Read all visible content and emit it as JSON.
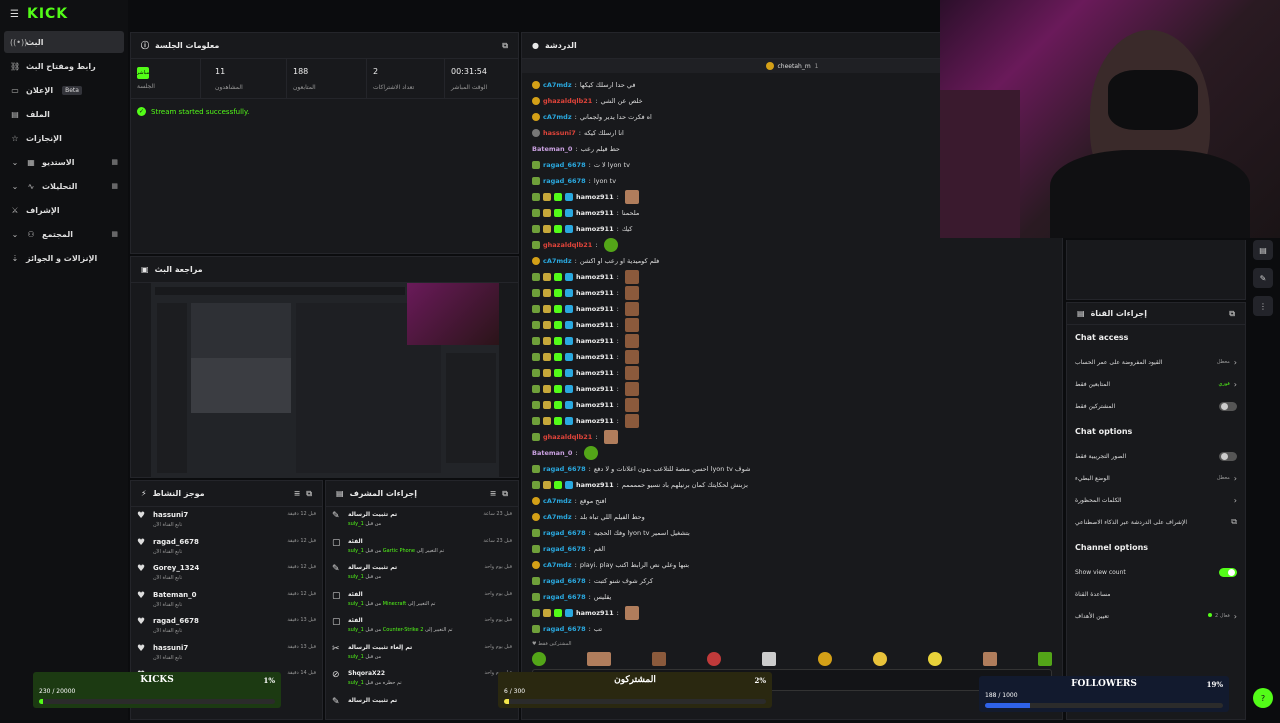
{
  "brand": "KICK",
  "nav": [
    {
      "label": "البث",
      "icon": "stream-icon",
      "active": true
    },
    {
      "label": "رابط ومفتاح البث",
      "icon": "link-icon"
    },
    {
      "label": "الإعلان",
      "icon": "ad-icon",
      "beta": "Beta"
    },
    {
      "label": "الملف",
      "icon": "file-icon"
    },
    {
      "label": "الإنجازات",
      "icon": "achievement-icon"
    },
    {
      "label": "الاستديو",
      "icon": "studio-icon",
      "chev": true
    },
    {
      "label": "التحليلات",
      "icon": "analytics-icon",
      "chev": true
    },
    {
      "label": "الإشراف",
      "icon": "moderation-icon"
    },
    {
      "label": "المجتمع",
      "icon": "community-icon",
      "chev": true
    },
    {
      "label": "الإنزالات و الجوائز",
      "icon": "drops-icon"
    }
  ],
  "session": {
    "title": "معلومات الجلسة",
    "live_badge": "مباشر",
    "live_label": "الجلسة",
    "stats": [
      {
        "value": "11",
        "label": "المشاهدون"
      },
      {
        "value": "188",
        "label": "المتابعون"
      },
      {
        "value": "2",
        "label": "تعداد الاشتراكات"
      },
      {
        "value": "00:31:54",
        "label": "الوقت المباشر"
      }
    ],
    "status": "Stream started successfully."
  },
  "preview_title": "مراجعة البث",
  "activity": {
    "title": "موجز النشاط",
    "items": [
      {
        "name": "hassuni7",
        "sub": "تابع القناة الآن",
        "time": "قبل 12 دقيقة"
      },
      {
        "name": "ragad_6678",
        "sub": "تابع القناة الآن",
        "time": "قبل 12 دقيقة"
      },
      {
        "name": "Gorey_1324",
        "sub": "تابع القناة الآن",
        "time": "قبل 12 دقيقة"
      },
      {
        "name": "Bateman_0",
        "sub": "تابع القناة الآن",
        "time": "قبل 12 دقيقة"
      },
      {
        "name": "ragad_6678",
        "sub": "تابع القناة الآن",
        "time": "قبل 13 دقيقة"
      },
      {
        "name": "hassuni7",
        "sub": "تابع القناة الآن",
        "time": "قبل 13 دقيقة"
      },
      {
        "name": "",
        "sub": "",
        "time": "قبل 14 دقيقة"
      }
    ]
  },
  "mod": {
    "title": "إجراءات المشرف",
    "items": [
      {
        "title": "تم تثبيت الرسالة",
        "sub": "من قبل",
        "user": "suly_1",
        "time": "قبل 23 ساعة"
      },
      {
        "title": "الفئة",
        "sub": "تم التغيير إلى",
        "user": "Gartic Phone",
        "by": "من قبل",
        "by_user": "suly_1",
        "time": "قبل 23 ساعة"
      },
      {
        "title": "تم تثبيت الرسالة",
        "sub": "من قبل",
        "user": "suly_1",
        "time": "قبل يوم واحد"
      },
      {
        "title": "الفئة",
        "sub": "تم التغيير إلى",
        "user": "Minecraft",
        "by": "من قبل",
        "by_user": "suly_1",
        "time": "قبل يوم واحد"
      },
      {
        "title": "الفئة",
        "sub": "تم التغيير إلى",
        "user": "Counter-Strike 2",
        "by": "من قبل",
        "by_user": "suly_1",
        "time": "قبل يوم واحد"
      },
      {
        "title": "تم إلغاء تثبيت الرسالة",
        "sub": "من قبل",
        "user": "suly_1",
        "time": "قبل يوم واحد"
      },
      {
        "title": "ShqoraX22",
        "sub": "تم حظره من قبل",
        "user": "suly_1",
        "time": "قبل يوم واحد"
      },
      {
        "title": "تم تثبيت الرسالة",
        "sub": "",
        "user": "",
        "time": "واحد"
      }
    ]
  },
  "chat": {
    "title": "الدردشة",
    "pinned_user": "cheetah_m",
    "pinned_count": "1",
    "lines": [
      {
        "user": "cA7mdz",
        "color": "#2aa9e0",
        "badges": [
          "b-gold"
        ],
        "msg": "في حدا ارسلك كيكها"
      },
      {
        "user": "ghazaldqlb21",
        "color": "#e0443a",
        "badges": [
          "b-gold"
        ],
        "msg": "خلص عن الشي"
      },
      {
        "user": "cA7mdz",
        "color": "#2aa9e0",
        "badges": [
          "b-gold"
        ],
        "msg": "اه فكرت حدا يدير ولجماني"
      },
      {
        "user": "hassuni7",
        "color": "#e0443a",
        "badges": [
          "b-grey"
        ],
        "msg": "انا ارسلك كيكه"
      },
      {
        "user": "Bateman_0",
        "color": "#c9a0e0",
        "badges": [],
        "msg": "حط فيلم رعب"
      },
      {
        "user": "ragad_6678",
        "color": "#2aa9e0",
        "badges": [
          "b-og"
        ],
        "msg": "لا ت lyon tv"
      },
      {
        "user": "ragad_6678",
        "color": "#2aa9e0",
        "badges": [
          "b-og"
        ],
        "msg": "lyon tv"
      },
      {
        "user": "hamoz911",
        "color": "#eee",
        "badges": [
          "b-og",
          "b-sub",
          "b-vip",
          "b-mod"
        ],
        "msg": "",
        "emote": "c"
      },
      {
        "user": "hamoz911",
        "color": "#eee",
        "badges": [
          "b-og",
          "b-sub",
          "b-vip",
          "b-mod"
        ],
        "msg": "ملحمنا"
      },
      {
        "user": "hamoz911",
        "color": "#eee",
        "badges": [
          "b-og",
          "b-sub",
          "b-vip",
          "b-mod"
        ],
        "msg": "كيك"
      },
      {
        "user": "ghazaldqlb21",
        "color": "#e0443a",
        "badges": [
          "b-og"
        ],
        "msg": "",
        "emote": "g"
      },
      {
        "user": "cA7mdz",
        "color": "#2aa9e0",
        "badges": [
          "b-gold"
        ],
        "msg": "فلم كوميدية او رعب او اكشن"
      },
      {
        "user": "hamoz911",
        "color": "#eee",
        "badges": [
          "b-og",
          "b-sub",
          "b-vip",
          "b-mod"
        ],
        "msg": "",
        "emote": "e"
      },
      {
        "user": "hamoz911",
        "color": "#eee",
        "badges": [
          "b-og",
          "b-sub",
          "b-vip",
          "b-mod"
        ],
        "msg": "",
        "emote": "e"
      },
      {
        "user": "hamoz911",
        "color": "#eee",
        "badges": [
          "b-og",
          "b-sub",
          "b-vip",
          "b-mod"
        ],
        "msg": "",
        "emote": "e"
      },
      {
        "user": "hamoz911",
        "color": "#eee",
        "badges": [
          "b-og",
          "b-sub",
          "b-vip",
          "b-mod"
        ],
        "msg": "",
        "emote": "e"
      },
      {
        "user": "hamoz911",
        "color": "#eee",
        "badges": [
          "b-og",
          "b-sub",
          "b-vip",
          "b-mod"
        ],
        "msg": "",
        "emote": "e"
      },
      {
        "user": "hamoz911",
        "color": "#eee",
        "badges": [
          "b-og",
          "b-sub",
          "b-vip",
          "b-mod"
        ],
        "msg": "",
        "emote": "e"
      },
      {
        "user": "hamoz911",
        "color": "#eee",
        "badges": [
          "b-og",
          "b-sub",
          "b-vip",
          "b-mod"
        ],
        "msg": "",
        "emote": "e"
      },
      {
        "user": "hamoz911",
        "color": "#eee",
        "badges": [
          "b-og",
          "b-sub",
          "b-vip",
          "b-mod"
        ],
        "msg": "",
        "emote": "e"
      },
      {
        "user": "hamoz911",
        "color": "#eee",
        "badges": [
          "b-og",
          "b-sub",
          "b-vip",
          "b-mod"
        ],
        "msg": "",
        "emote": "e"
      },
      {
        "user": "hamoz911",
        "color": "#eee",
        "badges": [
          "b-og",
          "b-sub",
          "b-vip",
          "b-mod"
        ],
        "msg": "",
        "emote": "e"
      },
      {
        "user": "ghazaldqlb21",
        "color": "#e0443a",
        "badges": [
          "b-og"
        ],
        "msg": "",
        "emote": "c"
      },
      {
        "user": "Bateman_0",
        "color": "#c9a0e0",
        "badges": [],
        "msg": "",
        "emote": "g"
      },
      {
        "user": "ragad_6678",
        "color": "#2aa9e0",
        "badges": [
          "b-og"
        ],
        "msg": "احسن منصة للتلاعب بدون اعلانات و لا دفع lyon tv شوف"
      },
      {
        "user": "hamoz911",
        "color": "#eee",
        "badges": [
          "b-og",
          "b-sub",
          "b-vip",
          "b-mod"
        ],
        "msg": "بزبنش لحكايتك كمان برنيلهم باد نسيو حممممم"
      },
      {
        "user": "cA7mdz",
        "color": "#2aa9e0",
        "badges": [
          "b-gold"
        ],
        "msg": "افتح موقع"
      },
      {
        "user": "cA7mdz",
        "color": "#2aa9e0",
        "badges": [
          "b-gold"
        ],
        "msg": "وحط الفيلم اللي تباه بلد"
      },
      {
        "user": "ragad_6678",
        "color": "#2aa9e0",
        "badges": [
          "b-og"
        ],
        "msg": "وفك الحجيه lyon tv بتشغيل اسمير"
      },
      {
        "user": "ragad_6678",
        "color": "#2aa9e0",
        "badges": [
          "b-og"
        ],
        "msg": "الغم"
      },
      {
        "user": "cA7mdz",
        "color": "#2aa9e0",
        "badges": [
          "b-gold"
        ],
        "msg": "playi. play بتبها وعلي نص الرابط اكتب"
      },
      {
        "user": "ragad_6678",
        "color": "#2aa9e0",
        "badges": [
          "b-og"
        ],
        "msg": "كركر شوف شنو كتبت"
      },
      {
        "user": "ragad_6678",
        "color": "#2aa9e0",
        "badges": [
          "b-og"
        ],
        "msg": "يقليس"
      },
      {
        "user": "hamoz911",
        "color": "#eee",
        "badges": [
          "b-og",
          "b-sub",
          "b-vip",
          "b-mod"
        ],
        "msg": "",
        "emote": "c"
      },
      {
        "user": "ragad_6678",
        "color": "#2aa9e0",
        "badges": [
          "b-og"
        ],
        "msg": "تب"
      }
    ],
    "subs_only": "المشتركين فقط"
  },
  "channel_actions": {
    "title": "إجراءات القناة",
    "chat_access": "Chat access",
    "access_rows": [
      {
        "label": "القيود المفروضة على عمر الحساب",
        "value": "معطل",
        "type": "chev"
      },
      {
        "label": "المتابعين فقط",
        "value": "فوري",
        "type": "chev",
        "green": true
      },
      {
        "label": "المشتركين فقط",
        "type": "toggle",
        "on": false
      }
    ],
    "chat_options": "Chat options",
    "option_rows": [
      {
        "label": "الصور التجريبية فقط",
        "type": "toggle",
        "on": false
      },
      {
        "label": "الوضع البطيء",
        "value": "معطل",
        "type": "chev"
      },
      {
        "label": "الكلمات المحظورة",
        "type": "chev"
      },
      {
        "label": "الإشراف على الدردشة عبر الذكاء الاصطناعي",
        "type": "ext"
      }
    ],
    "channel_options": "Channel options",
    "channel_rows": [
      {
        "label": "Show view count",
        "type": "toggle",
        "on": true
      },
      {
        "label": "مساعدة القناة",
        "type": "none"
      },
      {
        "label": "تعيين الأهداف",
        "value": "فعال 2",
        "type": "chev",
        "dot": true
      }
    ]
  },
  "goals": {
    "kicks": {
      "title": "KICKS",
      "pct": "1%",
      "count": "230 / 20000",
      "frac": 0.0115,
      "fill": "#53fc18"
    },
    "subs": {
      "title": "المشتركون",
      "pct": "2%",
      "count": "6 / 300",
      "frac": 0.02,
      "fill": "#f3e64a"
    },
    "followers": {
      "title": "FOLLOWERS",
      "pct": "19%",
      "count": "188 / 1000",
      "frac": 0.188,
      "fill": "#2f62e8"
    }
  },
  "colors": {
    "accent": "#53fc18",
    "panel": "#18191c",
    "bg": "#0b0c0e"
  }
}
